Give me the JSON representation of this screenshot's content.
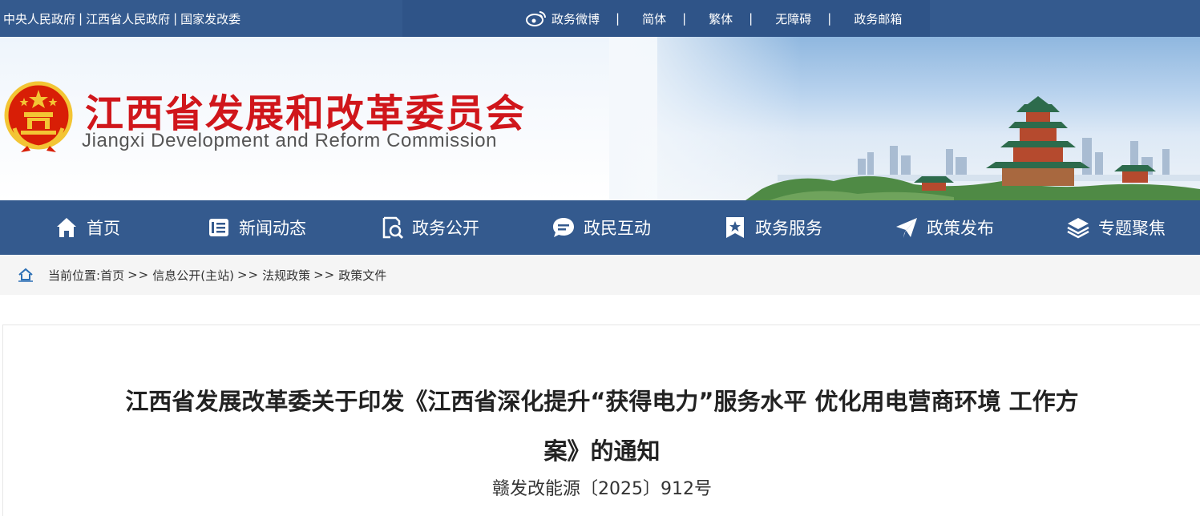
{
  "topbar": {
    "links": [
      "中央人民政府",
      "江西省人民政府",
      "国家发改委"
    ],
    "link_sep": "|",
    "right_links": [
      "政务微博",
      "简体",
      "繁体",
      "无障碍",
      "政务邮箱"
    ],
    "right_sep": "|"
  },
  "banner": {
    "title_cn": "江西省发展和改革委员会",
    "title_en": "Jiangxi Development and Reform Commission"
  },
  "nav": {
    "items": [
      {
        "label": "首页",
        "icon": "home-icon"
      },
      {
        "label": "新闻动态",
        "icon": "news-icon"
      },
      {
        "label": "政务公开",
        "icon": "document-search-icon"
      },
      {
        "label": "政民互动",
        "icon": "chat-icon"
      },
      {
        "label": "政务服务",
        "icon": "bookmark-star-icon"
      },
      {
        "label": "政策发布",
        "icon": "paper-plane-icon"
      },
      {
        "label": "专题聚焦",
        "icon": "layers-icon"
      }
    ]
  },
  "breadcrumb": {
    "prefix": "当前位置:",
    "items": [
      "首页",
      "信息公开(主站)",
      "法规政策",
      "政策文件"
    ],
    "sep": ">>"
  },
  "article": {
    "title": "江西省发展改革委关于印发《江西省深化提升“获得电力”服务水平 优化用电营商环境 工作方案》的通知",
    "doc_number": "赣发改能源〔2025〕912号"
  },
  "colors": {
    "primary_blue": "#345a8e",
    "title_red": "#d0161b"
  }
}
